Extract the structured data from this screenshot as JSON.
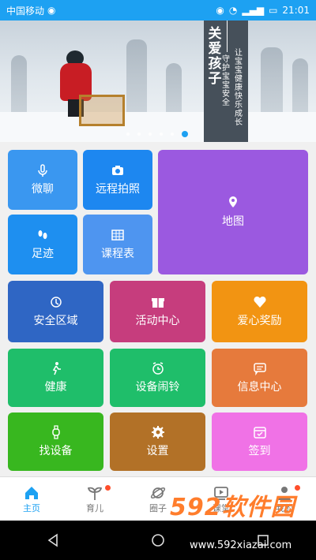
{
  "status_bar": {
    "carrier": "中国移动",
    "time": "21:01"
  },
  "banner": {
    "title_chars": [
      "关",
      "爱",
      "孩",
      "子"
    ],
    "subtitle_line1": [
      "守",
      "护",
      "宝",
      "宝",
      "安",
      "全"
    ],
    "subtitle_line2": [
      "让",
      "宝",
      "宝",
      "健",
      "康",
      "快",
      "乐",
      "成",
      "长"
    ],
    "slide_count": 6,
    "active_slide": 5
  },
  "tiles": [
    {
      "label": "微聊",
      "icon": "microphone-icon",
      "color": "#3a97f0"
    },
    {
      "label": "远程拍照",
      "icon": "camera-icon",
      "color": "#1d87f0"
    },
    {
      "label": "地图",
      "icon": "map-pin-icon",
      "color": "#9b59e0"
    },
    {
      "label": "足迹",
      "icon": "footprints-icon",
      "color": "#1e8ff0"
    },
    {
      "label": "课程表",
      "icon": "table-icon",
      "color": "#4e95f0"
    },
    {
      "label": "安全区域",
      "icon": "safety-icon",
      "color": "#2f66c4"
    },
    {
      "label": "活动中心",
      "icon": "gift-icon",
      "color": "#c63d7d"
    },
    {
      "label": "爱心奖励",
      "icon": "heart-icon",
      "color": "#f29412"
    },
    {
      "label": "健康",
      "icon": "runner-icon",
      "color": "#1fbe6a"
    },
    {
      "label": "设备闹铃",
      "icon": "alarm-clock-icon",
      "color": "#1fbe6a"
    },
    {
      "label": "信息中心",
      "icon": "message-icon",
      "color": "#e67a3c"
    },
    {
      "label": "找设备",
      "icon": "watch-icon",
      "color": "#38b71f"
    },
    {
      "label": "设置",
      "icon": "gear-icon",
      "color": "#b27127"
    },
    {
      "label": "签到",
      "icon": "calendar-check-icon",
      "color": "#f072e6"
    }
  ],
  "bottom_nav": {
    "items": [
      {
        "label": "主页",
        "icon": "home-icon",
        "badge": false
      },
      {
        "label": "育儿",
        "icon": "sprout-icon",
        "badge": true
      },
      {
        "label": "圈子",
        "icon": "planet-icon",
        "badge": false
      },
      {
        "label": "课堂",
        "icon": "video-icon",
        "badge": false
      },
      {
        "label": "我的",
        "icon": "user-icon",
        "badge": true
      }
    ],
    "active_index": 0
  },
  "watermark": {
    "logo": "592软件园",
    "url": "www.592xiazai.com"
  }
}
